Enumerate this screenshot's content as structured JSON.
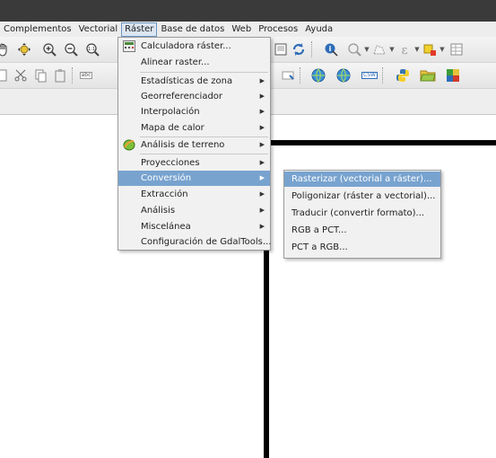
{
  "menubar": {
    "items": [
      {
        "label": "Complementos"
      },
      {
        "label": "Vectorial"
      },
      {
        "label": "Ráster"
      },
      {
        "label": "Base de datos"
      },
      {
        "label": "Web"
      },
      {
        "label": "Procesos"
      },
      {
        "label": "Ayuda"
      }
    ]
  },
  "raster_menu": {
    "items": [
      {
        "label": "Calculadora ráster..."
      },
      {
        "label": "Alinear raster..."
      },
      {
        "label": "Estadísticas de zona"
      },
      {
        "label": "Georreferenciador"
      },
      {
        "label": "Interpolación"
      },
      {
        "label": "Mapa de calor"
      },
      {
        "label": "Análisis de terreno"
      },
      {
        "label": "Proyecciones"
      },
      {
        "label": "Conversión"
      },
      {
        "label": "Extracción"
      },
      {
        "label": "Análisis"
      },
      {
        "label": "Miscelánea"
      },
      {
        "label": "Configuración de GdalTools..."
      }
    ]
  },
  "conversion_submenu": {
    "items": [
      {
        "label": "Rasterizar (vectorial a ráster)..."
      },
      {
        "label": "Poligonizar (ráster a vectorial)..."
      },
      {
        "label": "Traducir (convertir formato)..."
      },
      {
        "label": "RGB a PCT..."
      },
      {
        "label": "PCT a RGB..."
      }
    ]
  },
  "toolbar": {
    "abc_label": "abc",
    "csw_label": "CSW"
  },
  "colors": {
    "highlight": "#78a3cf",
    "menu_bg": "#f1f1f1",
    "titlebar": "#3a3a3a"
  }
}
